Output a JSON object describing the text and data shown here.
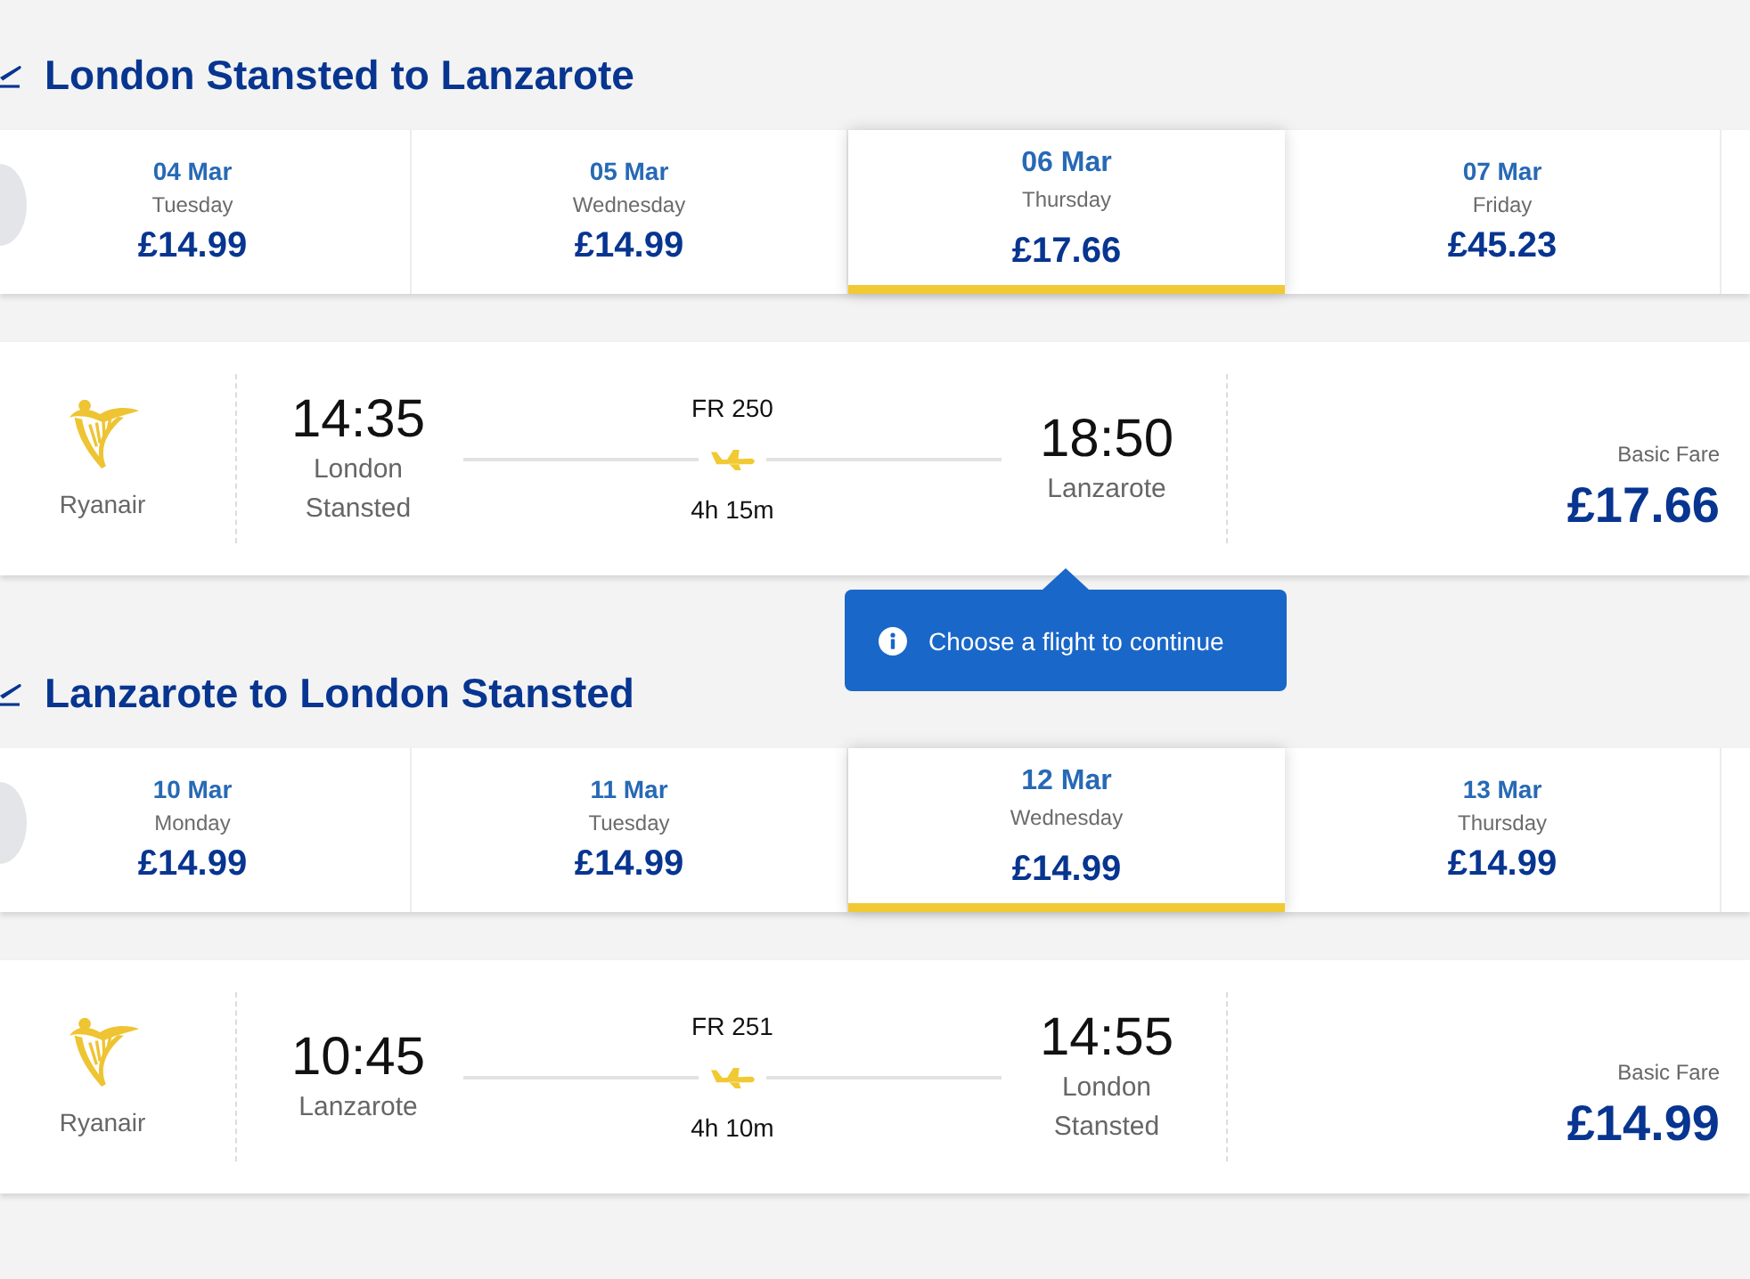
{
  "journeys": [
    {
      "title": "London Stansted to Lanzarote",
      "dates": [
        {
          "date": "04 Mar",
          "day": "Tuesday",
          "price": "£14.99",
          "selected": false
        },
        {
          "date": "05 Mar",
          "day": "Wednesday",
          "price": "£14.99",
          "selected": false
        },
        {
          "date": "06 Mar",
          "day": "Thursday",
          "price": "£17.66",
          "selected": true
        },
        {
          "date": "07 Mar",
          "day": "Friday",
          "price": "£45.23",
          "selected": false
        }
      ],
      "flight": {
        "airline": "Ryanair",
        "departure": {
          "time": "14:35",
          "airport": "London Stansted"
        },
        "flight_number": "FR 250",
        "duration": "4h 15m",
        "arrival": {
          "time": "18:50",
          "airport": "Lanzarote"
        },
        "fare_label": "Basic Fare",
        "price": "£17.66"
      },
      "tooltip": {
        "text": "Choose a flight to continue"
      }
    },
    {
      "title": "Lanzarote to London Stansted",
      "dates": [
        {
          "date": "10 Mar",
          "day": "Monday",
          "price": "£14.99",
          "selected": false
        },
        {
          "date": "11 Mar",
          "day": "Tuesday",
          "price": "£14.99",
          "selected": false
        },
        {
          "date": "12 Mar",
          "day": "Wednesday",
          "price": "£14.99",
          "selected": true
        },
        {
          "date": "13 Mar",
          "day": "Thursday",
          "price": "£14.99",
          "selected": false
        }
      ],
      "flight": {
        "airline": "Ryanair",
        "departure": {
          "time": "10:45",
          "airport": "Lanzarote"
        },
        "flight_number": "FR 251",
        "duration": "4h 10m",
        "arrival": {
          "time": "14:55",
          "airport": "London Stansted"
        },
        "fare_label": "Basic Fare",
        "price": "£14.99"
      }
    }
  ]
}
